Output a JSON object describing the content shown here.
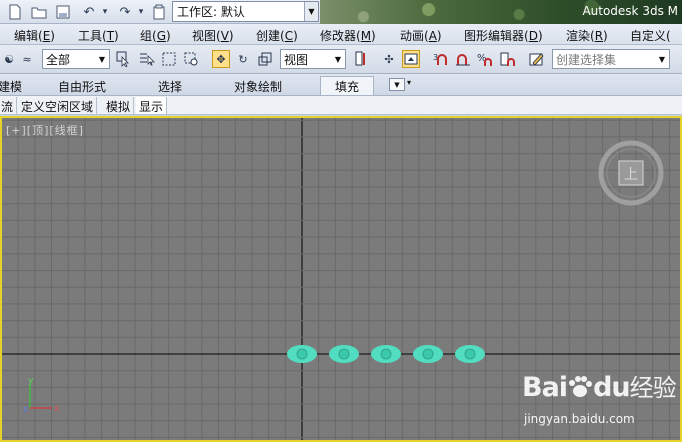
{
  "title_bar": {
    "workspace_label": "工作区: 默认",
    "app_title": "Autodesk 3ds M",
    "quick_access_icons": [
      "new-file-icon",
      "open-folder-icon",
      "save-icon",
      "undo-icon",
      "redo-icon",
      "project-folder-icon"
    ]
  },
  "menu": {
    "items": [
      {
        "text": "编辑(",
        "key": "E",
        "end": ")"
      },
      {
        "text": "工具(",
        "key": "T",
        "end": ")"
      },
      {
        "text": "组(",
        "key": "G",
        "end": ")"
      },
      {
        "text": "视图(",
        "key": "V",
        "end": ")"
      },
      {
        "text": "创建(",
        "key": "C",
        "end": ")"
      },
      {
        "text": "修改器(",
        "key": "M",
        "end": ")"
      },
      {
        "text": "动画(",
        "key": "A",
        "end": ")"
      },
      {
        "text": "图形编辑器(",
        "key": "D",
        "end": ")"
      },
      {
        "text": "渲染(",
        "key": "R",
        "end": ")"
      },
      {
        "text": "自定义(",
        "key": "",
        "end": ""
      }
    ]
  },
  "toolbar": {
    "filter_value": "全部",
    "reference_coord_value": "视图",
    "selection_set_placeholder": "创建选择集"
  },
  "ribbon": {
    "tabs": [
      "建模",
      "自由形式",
      "选择",
      "对象绘制",
      "填充"
    ],
    "selected_tab": "填充"
  },
  "subtabs": {
    "items": [
      "流",
      "定义空闲区域",
      "模拟",
      "显示"
    ]
  },
  "viewport": {
    "label": "[+][顶][线框]",
    "active_border_color": "#e4d22a",
    "background_color": "#7b7b7b",
    "grid_color": "#6a6a6a",
    "object_color": "#52dcc0",
    "object_count": 5,
    "viewcube_label": "上",
    "axis_labels": {
      "x": "x",
      "y": "y",
      "z": "z"
    }
  },
  "watermark": {
    "logo_text": "Bai",
    "logo_text_2": "du",
    "logo_cn": "经验",
    "url": "jingyan.baidu.com"
  }
}
